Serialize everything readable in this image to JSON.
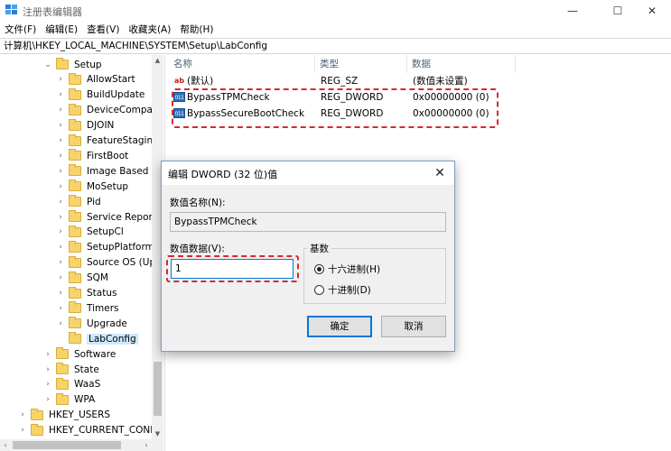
{
  "window": {
    "title": "注册表编辑器",
    "minimize": "—",
    "maximize": "☐",
    "close": "✕"
  },
  "menu": [
    "文件(F)",
    "编辑(E)",
    "查看(V)",
    "收藏夹(A)",
    "帮助(H)"
  ],
  "address": "计算机\\HKEY_LOCAL_MACHINE\\SYSTEM\\Setup\\LabConfig",
  "tree": [
    {
      "label": "Setup",
      "indent": 1,
      "expand": "down"
    },
    {
      "label": "AllowStart",
      "indent": 2,
      "expand": "right"
    },
    {
      "label": "BuildUpdate",
      "indent": 2,
      "expand": "right"
    },
    {
      "label": "DeviceCompat",
      "indent": 2,
      "expand": "right"
    },
    {
      "label": "DJOIN",
      "indent": 2,
      "expand": "right"
    },
    {
      "label": "FeatureStaging",
      "indent": 2,
      "expand": "right"
    },
    {
      "label": "FirstBoot",
      "indent": 2,
      "expand": "right"
    },
    {
      "label": "Image Based Se",
      "indent": 2,
      "expand": "right"
    },
    {
      "label": "MoSetup",
      "indent": 2,
      "expand": "right"
    },
    {
      "label": "Pid",
      "indent": 2,
      "expand": "right"
    },
    {
      "label": "Service Reportin",
      "indent": 2,
      "expand": "right"
    },
    {
      "label": "SetupCl",
      "indent": 2,
      "expand": "right"
    },
    {
      "label": "SetupPlatform",
      "indent": 2,
      "expand": "right"
    },
    {
      "label": "Source OS (Upc",
      "indent": 2,
      "expand": "right"
    },
    {
      "label": "SQM",
      "indent": 2,
      "expand": "right"
    },
    {
      "label": "Status",
      "indent": 2,
      "expand": "right"
    },
    {
      "label": "Timers",
      "indent": 2,
      "expand": "right"
    },
    {
      "label": "Upgrade",
      "indent": 2,
      "expand": "right"
    },
    {
      "label": "LabConfig",
      "indent": 2,
      "expand": "none",
      "selected": true
    },
    {
      "label": "Software",
      "indent": 1,
      "expand": "right"
    },
    {
      "label": "State",
      "indent": 1,
      "expand": "right"
    },
    {
      "label": "WaaS",
      "indent": 1,
      "expand": "right"
    },
    {
      "label": "WPA",
      "indent": 1,
      "expand": "right"
    },
    {
      "label": "HKEY_USERS",
      "indent": 0,
      "expand": "right"
    },
    {
      "label": "HKEY_CURRENT_CONFIG",
      "indent": 0,
      "expand": "right"
    }
  ],
  "list": {
    "columns": [
      "名称",
      "类型",
      "数据"
    ],
    "rows": [
      {
        "icon": "string-value-icon",
        "icon_glyph": "ab",
        "name": "(默认)",
        "type": "REG_SZ",
        "data": "(数值未设置)"
      },
      {
        "icon": "dword-value-icon",
        "icon_glyph": "011",
        "name": "BypassTPMCheck",
        "type": "REG_DWORD",
        "data": "0x00000000 (0)"
      },
      {
        "icon": "dword-value-icon",
        "icon_glyph": "011",
        "name": "BypassSecureBootCheck",
        "type": "REG_DWORD",
        "data": "0x00000000 (0)"
      }
    ]
  },
  "dialog": {
    "title": "编辑 DWORD (32 位)值",
    "close": "✕",
    "name_label": "数值名称(N):",
    "name_value": "BypassTPMCheck",
    "data_label": "数值数据(V):",
    "data_value": "1",
    "base_label": "基数",
    "hex_label": "十六进制(H)",
    "dec_label": "十进制(D)",
    "base_selected": "hex",
    "ok": "确定",
    "cancel": "取消"
  },
  "colors": {
    "highlight_dash": "#d9292b",
    "selection": "#cce8ff",
    "focus": "#0078d7"
  }
}
